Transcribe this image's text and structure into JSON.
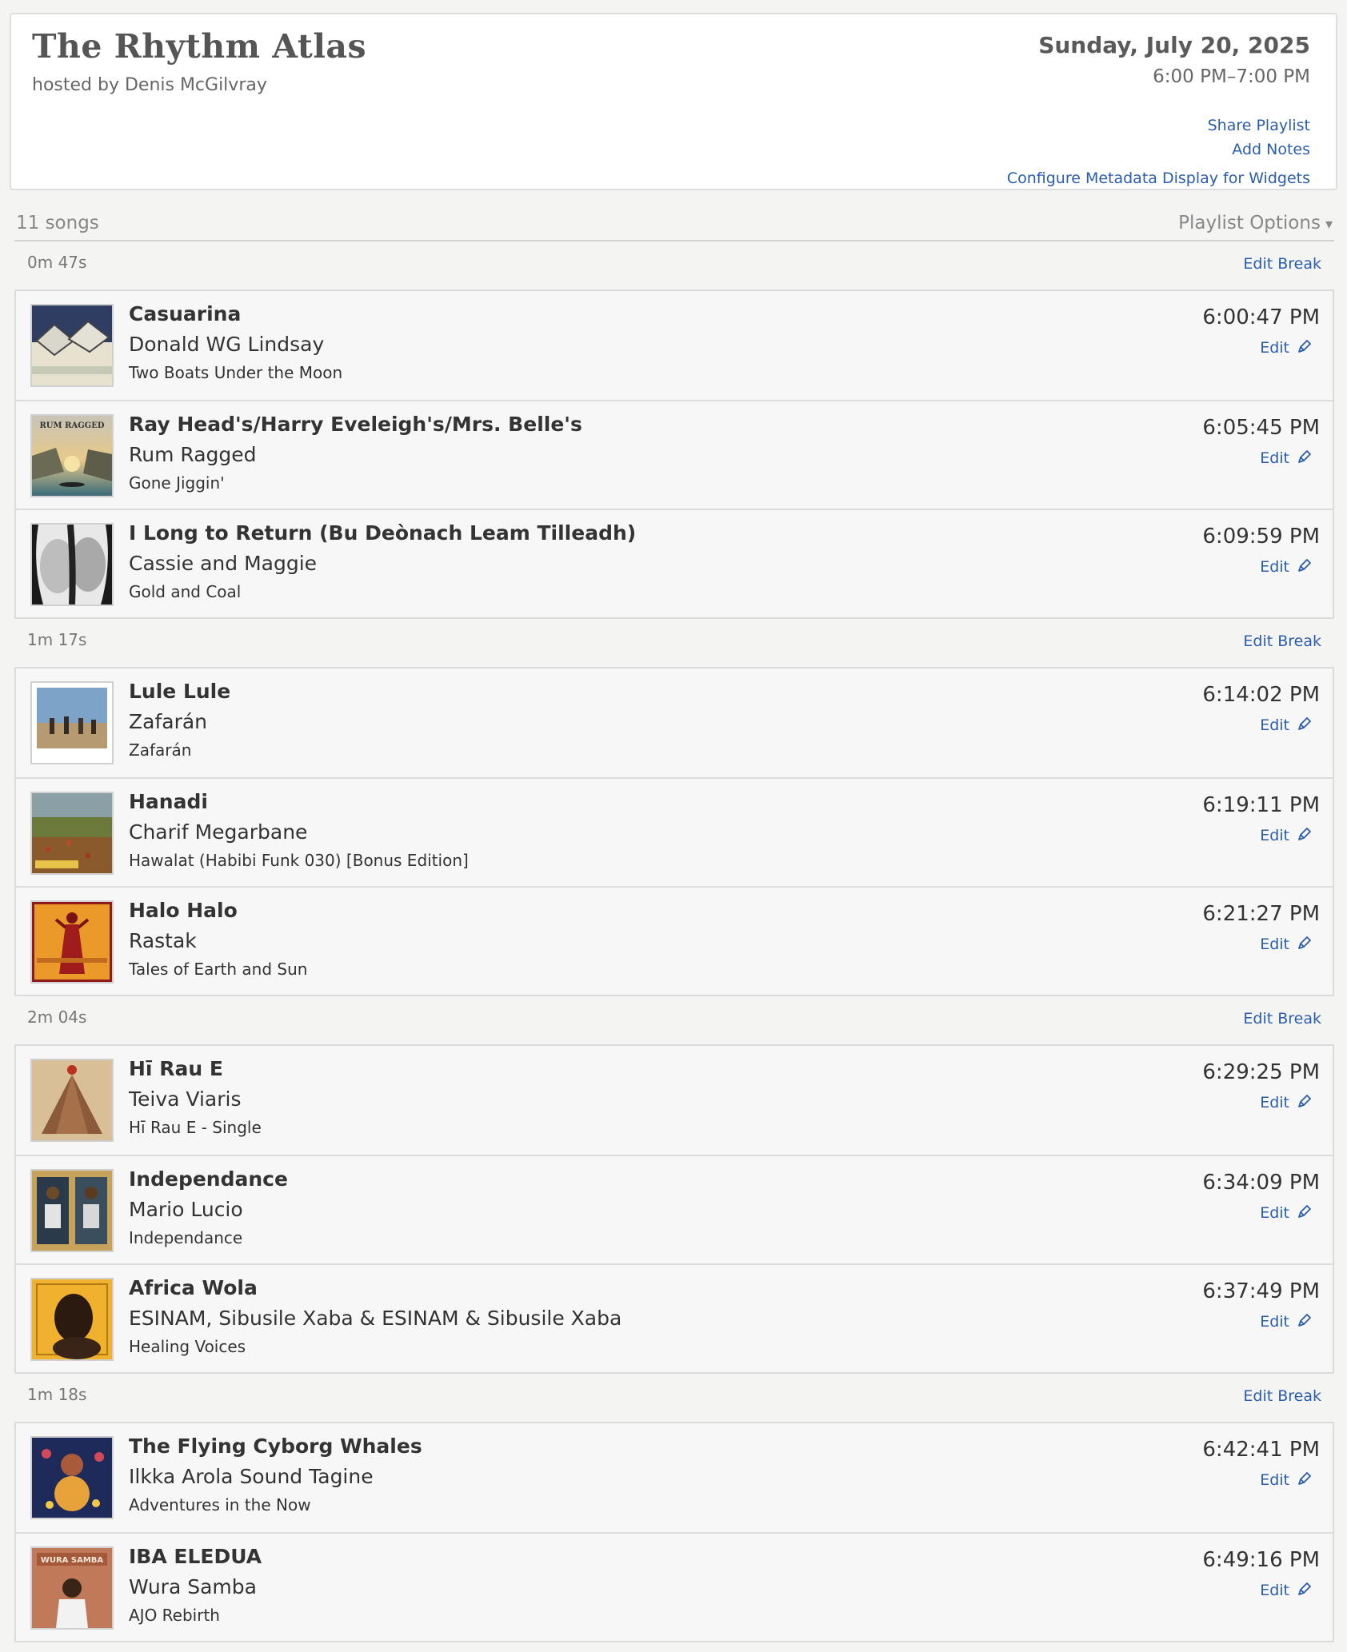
{
  "show": {
    "title": "The Rhythm Atlas",
    "host": "hosted by Denis McGilvray",
    "date": "Sunday, July 20, 2025",
    "time": "6:00 PM–7:00 PM"
  },
  "header_links": {
    "share": "Share Playlist",
    "notes": "Add Notes",
    "configure": "Configure Metadata Display for Widgets"
  },
  "playlist": {
    "song_count": "11 songs",
    "options_label": "Playlist Options",
    "caret_icon": "▾"
  },
  "labels": {
    "edit": "Edit",
    "edit_break": "Edit Break"
  },
  "breaks": [
    {
      "duration": "0m 47s"
    },
    {
      "duration": "1m 17s"
    },
    {
      "duration": "2m 04s"
    },
    {
      "duration": "1m 18s"
    }
  ],
  "groups": [
    {
      "songs": [
        {
          "title": "Casuarina",
          "artist": "Donald WG Lindsay",
          "album": "Two Boats Under the Moon",
          "time": "6:00:47 PM"
        },
        {
          "title": "Ray Head's/Harry Eveleigh's/Mrs. Belle's",
          "artist": "Rum Ragged",
          "album": "Gone Jiggin'",
          "time": "6:05:45 PM",
          "art_text": "RUM RAGGED"
        },
        {
          "title": "I Long to Return (Bu Deònach Leam Tilleadh)",
          "artist": "Cassie and Maggie",
          "album": "Gold and Coal",
          "time": "6:09:59 PM"
        }
      ]
    },
    {
      "songs": [
        {
          "title": "Lule Lule",
          "artist": "Zafarán",
          "album": "Zafarán",
          "time": "6:14:02 PM"
        },
        {
          "title": "Hanadi",
          "artist": "Charif Megarbane",
          "album": "Hawalat (Habibi Funk 030) [Bonus Edition]",
          "time": "6:19:11 PM"
        },
        {
          "title": "Halo Halo",
          "artist": "Rastak",
          "album": "Tales of Earth and Sun",
          "time": "6:21:27 PM"
        }
      ]
    },
    {
      "songs": [
        {
          "title": "Hī Rau E",
          "artist": "Teiva Viaris",
          "album": "Hī Rau E - Single",
          "time": "6:29:25 PM"
        },
        {
          "title": "Independance",
          "artist": "Mario Lucio",
          "album": "Independance",
          "time": "6:34:09 PM"
        },
        {
          "title": "Africa Wola",
          "artist": "ESINAM, Sibusile Xaba & ESINAM & Sibusile Xaba",
          "album": "Healing Voices",
          "time": "6:37:49 PM"
        }
      ]
    },
    {
      "songs": [
        {
          "title": "The Flying Cyborg Whales",
          "artist": "Ilkka Arola Sound Tagine",
          "album": "Adventures in the Now",
          "time": "6:42:41 PM"
        },
        {
          "title": "IBA ELEDUA",
          "artist": "Wura Samba",
          "album": "AJO Rebirth",
          "time": "6:49:16 PM",
          "art_text": "WURA SAMBA"
        }
      ]
    }
  ]
}
